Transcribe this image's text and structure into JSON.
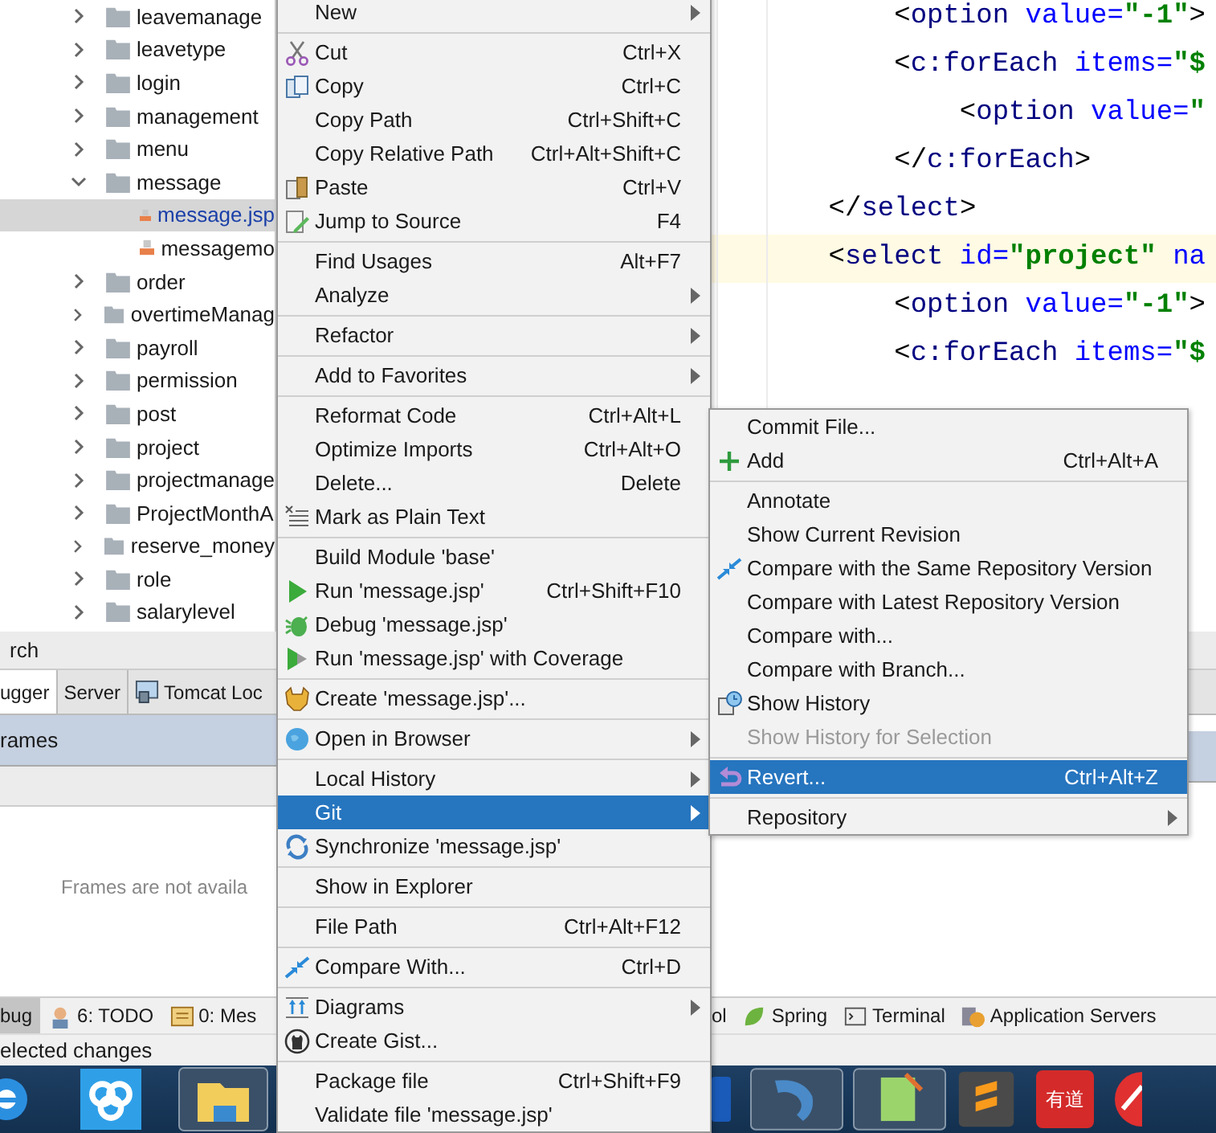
{
  "project_tree": {
    "items": [
      {
        "name": "leavemanage",
        "kind": "folder",
        "expanded": false,
        "selected": false
      },
      {
        "name": "leavetype",
        "kind": "folder",
        "expanded": false,
        "selected": false
      },
      {
        "name": "login",
        "kind": "folder",
        "expanded": false,
        "selected": false
      },
      {
        "name": "management",
        "kind": "folder",
        "expanded": false,
        "selected": false
      },
      {
        "name": "menu",
        "kind": "folder",
        "expanded": false,
        "selected": false
      },
      {
        "name": "message",
        "kind": "folder",
        "expanded": true,
        "selected": false,
        "children": [
          {
            "name": "message.jsp",
            "kind": "file",
            "selected": true
          },
          {
            "name": "messagemo",
            "kind": "file",
            "selected": false
          }
        ]
      },
      {
        "name": "order",
        "kind": "folder",
        "expanded": false,
        "selected": false
      },
      {
        "name": "overtimeManag",
        "kind": "folder",
        "expanded": false,
        "selected": false
      },
      {
        "name": "payroll",
        "kind": "folder",
        "expanded": false,
        "selected": false
      },
      {
        "name": "permission",
        "kind": "folder",
        "expanded": false,
        "selected": false
      },
      {
        "name": "post",
        "kind": "folder",
        "expanded": false,
        "selected": false
      },
      {
        "name": "project",
        "kind": "folder",
        "expanded": false,
        "selected": false
      },
      {
        "name": "projectmanage",
        "kind": "folder",
        "expanded": false,
        "selected": false
      },
      {
        "name": "ProjectMonthA",
        "kind": "folder",
        "expanded": false,
        "selected": false
      },
      {
        "name": "reserve_money",
        "kind": "folder",
        "expanded": false,
        "selected": false
      },
      {
        "name": "role",
        "kind": "folder",
        "expanded": false,
        "selected": false
      },
      {
        "name": "salarylevel",
        "kind": "folder",
        "expanded": false,
        "selected": false
      }
    ]
  },
  "editor": {
    "lines": [
      {
        "current": false,
        "tokens": [
          {
            "text": "        <",
            "kind": "punct"
          },
          {
            "text": "option",
            "kind": "tag"
          },
          {
            "text": " value=",
            "kind": "attr"
          },
          {
            "text": "\"-1\"",
            "kind": "value"
          },
          {
            "text": ">",
            "kind": "punct"
          }
        ]
      },
      {
        "current": false,
        "tokens": [
          {
            "text": "        <",
            "kind": "punct"
          },
          {
            "text": "c:forEach",
            "kind": "tag"
          },
          {
            "text": " items=",
            "kind": "attr"
          },
          {
            "text": "\"$",
            "kind": "value"
          }
        ]
      },
      {
        "current": false,
        "tokens": [
          {
            "text": "            <",
            "kind": "punct"
          },
          {
            "text": "option",
            "kind": "tag"
          },
          {
            "text": " value=",
            "kind": "attr"
          },
          {
            "text": "\"",
            "kind": "value"
          }
        ]
      },
      {
        "current": false,
        "tokens": [
          {
            "text": "        </",
            "kind": "punct"
          },
          {
            "text": "c:forEach",
            "kind": "tag"
          },
          {
            "text": ">",
            "kind": "punct"
          }
        ]
      },
      {
        "current": false,
        "tokens": [
          {
            "text": "    </",
            "kind": "punct"
          },
          {
            "text": "select",
            "kind": "tag"
          },
          {
            "text": ">",
            "kind": "punct"
          }
        ]
      },
      {
        "current": true,
        "tokens": [
          {
            "text": "    <",
            "kind": "punct"
          },
          {
            "text": "select",
            "kind": "tag"
          },
          {
            "text": " id=",
            "kind": "attr"
          },
          {
            "text": "\"project\"",
            "kind": "value"
          },
          {
            "text": " na",
            "kind": "attr"
          }
        ]
      },
      {
        "current": false,
        "tokens": [
          {
            "text": "        <",
            "kind": "punct"
          },
          {
            "text": "option",
            "kind": "tag"
          },
          {
            "text": " value=",
            "kind": "attr"
          },
          {
            "text": "\"-1\"",
            "kind": "value"
          },
          {
            "text": ">",
            "kind": "punct"
          }
        ]
      },
      {
        "current": false,
        "tokens": [
          {
            "text": "        <",
            "kind": "punct"
          },
          {
            "text": "c:forEach",
            "kind": "tag"
          },
          {
            "text": " items=",
            "kind": "attr"
          },
          {
            "text": "\"$",
            "kind": "value"
          }
        ]
      }
    ]
  },
  "debug_panel": {
    "title": "rch",
    "tabs": [
      {
        "label": "ugger",
        "selected": true
      },
      {
        "label": "Server",
        "selected": false
      },
      {
        "label": "Tomcat Loc",
        "selected": false
      }
    ],
    "frames_header": "rames",
    "empty_message": "Frames are not availa"
  },
  "tool_buttons_left": [
    {
      "label": "bug",
      "selected": true
    },
    {
      "label": "6: TODO",
      "selected": false
    },
    {
      "label": "0: Mes",
      "selected": false
    }
  ],
  "tool_buttons_right": [
    {
      "label": "ol",
      "selected": false
    },
    {
      "label": "Spring",
      "selected": false
    },
    {
      "label": "Terminal",
      "selected": false
    },
    {
      "label": "Application Servers",
      "selected": false
    }
  ],
  "status_bar": "elected changes",
  "context_menu": {
    "items": [
      {
        "kind": "item",
        "label": "New",
        "submenu": true,
        "selected": false
      },
      {
        "kind": "separator"
      },
      {
        "kind": "item",
        "label": "Cut",
        "shortcut": "Ctrl+X",
        "submenu": false,
        "selected": false
      },
      {
        "kind": "item",
        "label": "Copy",
        "shortcut": "Ctrl+C",
        "submenu": false,
        "selected": false
      },
      {
        "kind": "item",
        "label": "Copy Path",
        "shortcut": "Ctrl+Shift+C",
        "submenu": false,
        "selected": false
      },
      {
        "kind": "item",
        "label": "Copy Relative Path",
        "shortcut": "Ctrl+Alt+Shift+C",
        "submenu": false,
        "selected": false
      },
      {
        "kind": "item",
        "label": "Paste",
        "shortcut": "Ctrl+V",
        "submenu": false,
        "selected": false
      },
      {
        "kind": "item",
        "label": "Jump to Source",
        "shortcut": "F4",
        "submenu": false,
        "selected": false
      },
      {
        "kind": "separator"
      },
      {
        "kind": "item",
        "label": "Find Usages",
        "shortcut": "Alt+F7",
        "submenu": false,
        "selected": false
      },
      {
        "kind": "item",
        "label": "Analyze",
        "submenu": true,
        "selected": false
      },
      {
        "kind": "separator"
      },
      {
        "kind": "item",
        "label": "Refactor",
        "submenu": true,
        "selected": false
      },
      {
        "kind": "separator"
      },
      {
        "kind": "item",
        "label": "Add to Favorites",
        "submenu": true,
        "selected": false
      },
      {
        "kind": "separator"
      },
      {
        "kind": "item",
        "label": "Reformat Code",
        "shortcut": "Ctrl+Alt+L",
        "submenu": false,
        "selected": false
      },
      {
        "kind": "item",
        "label": "Optimize Imports",
        "shortcut": "Ctrl+Alt+O",
        "submenu": false,
        "selected": false
      },
      {
        "kind": "item",
        "label": "Delete...",
        "shortcut": "Delete",
        "submenu": false,
        "selected": false
      },
      {
        "kind": "item",
        "label": "Mark as Plain Text",
        "submenu": false,
        "selected": false
      },
      {
        "kind": "separator"
      },
      {
        "kind": "item",
        "label": "Build Module 'base'",
        "submenu": false,
        "selected": false
      },
      {
        "kind": "item",
        "label": "Run 'message.jsp'",
        "shortcut": "Ctrl+Shift+F10",
        "submenu": false,
        "selected": false
      },
      {
        "kind": "item",
        "label": "Debug 'message.jsp'",
        "submenu": false,
        "selected": false
      },
      {
        "kind": "item",
        "label": "Run 'message.jsp' with Coverage",
        "submenu": false,
        "selected": false
      },
      {
        "kind": "separator"
      },
      {
        "kind": "item",
        "label": "Create 'message.jsp'...",
        "submenu": false,
        "selected": false
      },
      {
        "kind": "separator"
      },
      {
        "kind": "item",
        "label": "Open in Browser",
        "submenu": true,
        "selected": false
      },
      {
        "kind": "separator"
      },
      {
        "kind": "item",
        "label": "Local History",
        "submenu": true,
        "selected": false
      },
      {
        "kind": "item",
        "label": "Git",
        "submenu": true,
        "selected": true
      },
      {
        "kind": "item",
        "label": "Synchronize 'message.jsp'",
        "submenu": false,
        "selected": false
      },
      {
        "kind": "separator"
      },
      {
        "kind": "item",
        "label": "Show in Explorer",
        "submenu": false,
        "selected": false
      },
      {
        "kind": "separator"
      },
      {
        "kind": "item",
        "label": "File Path",
        "shortcut": "Ctrl+Alt+F12",
        "submenu": false,
        "selected": false
      },
      {
        "kind": "separator"
      },
      {
        "kind": "item",
        "label": "Compare With...",
        "shortcut": "Ctrl+D",
        "submenu": false,
        "selected": false
      },
      {
        "kind": "separator"
      },
      {
        "kind": "item",
        "label": "Diagrams",
        "submenu": true,
        "selected": false
      },
      {
        "kind": "item",
        "label": "Create Gist...",
        "submenu": false,
        "selected": false
      },
      {
        "kind": "separator"
      },
      {
        "kind": "item",
        "label": "Package file",
        "shortcut": "Ctrl+Shift+F9",
        "submenu": false,
        "selected": false
      },
      {
        "kind": "item",
        "label": "Validate file 'message.jsp'",
        "submenu": false,
        "selected": false
      }
    ]
  },
  "git_submenu": {
    "items": [
      {
        "kind": "item",
        "label": "Commit File...",
        "submenu": false,
        "selected": false,
        "disabled": false
      },
      {
        "kind": "item",
        "label": "Add",
        "shortcut": "Ctrl+Alt+A",
        "submenu": false,
        "selected": false,
        "disabled": false
      },
      {
        "kind": "separator"
      },
      {
        "kind": "item",
        "label": "Annotate",
        "submenu": false,
        "selected": false,
        "disabled": false
      },
      {
        "kind": "item",
        "label": "Show Current Revision",
        "submenu": false,
        "selected": false,
        "disabled": false
      },
      {
        "kind": "item",
        "label": "Compare with the Same Repository Version",
        "submenu": false,
        "selected": false,
        "disabled": false
      },
      {
        "kind": "item",
        "label": "Compare with Latest Repository Version",
        "submenu": false,
        "selected": false,
        "disabled": false
      },
      {
        "kind": "item",
        "label": "Compare with...",
        "submenu": false,
        "selected": false,
        "disabled": false
      },
      {
        "kind": "item",
        "label": "Compare with Branch...",
        "submenu": false,
        "selected": false,
        "disabled": false
      },
      {
        "kind": "item",
        "label": "Show History",
        "submenu": false,
        "selected": false,
        "disabled": false
      },
      {
        "kind": "item",
        "label": "Show History for Selection",
        "submenu": false,
        "selected": false,
        "disabled": true
      },
      {
        "kind": "separator"
      },
      {
        "kind": "item",
        "label": "Revert...",
        "shortcut": "Ctrl+Alt+Z",
        "submenu": false,
        "selected": true,
        "disabled": false
      },
      {
        "kind": "separator"
      },
      {
        "kind": "item",
        "label": "Repository",
        "submenu": true,
        "selected": false,
        "disabled": false
      }
    ]
  },
  "taskbar": {
    "dictionary_label": "有道"
  }
}
